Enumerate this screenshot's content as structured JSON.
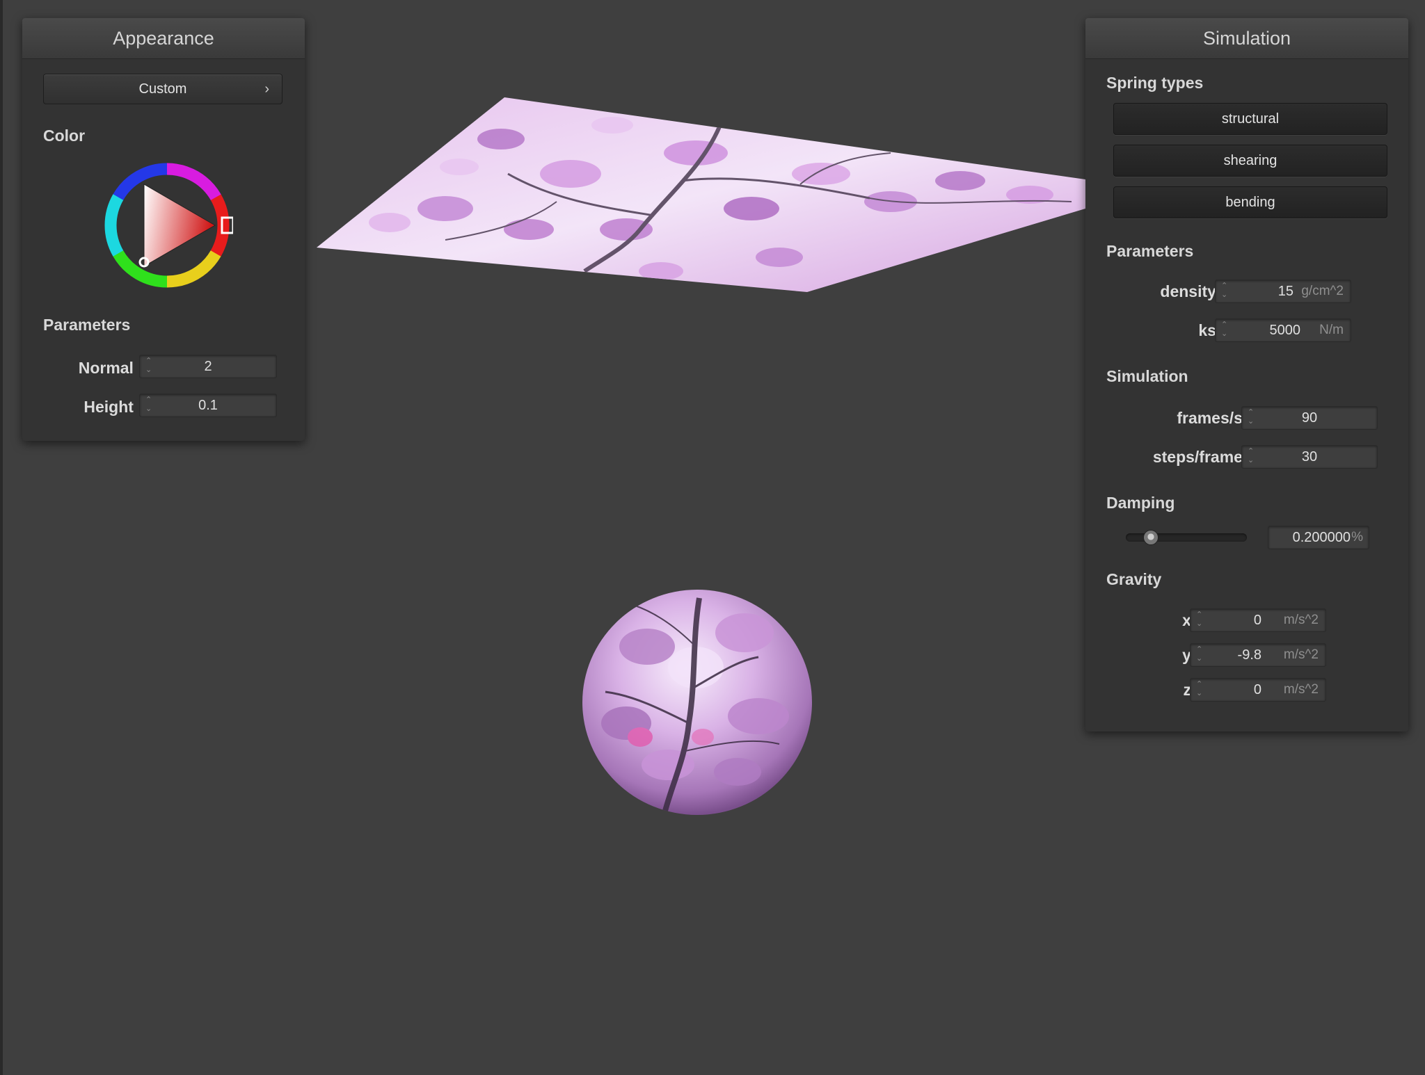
{
  "appearance": {
    "title": "Appearance",
    "preset_label": "Custom",
    "preset_chevron": "›",
    "color_label": "Color",
    "params_label": "Parameters",
    "normal_label": "Normal :",
    "normal_value": "2",
    "height_label": "Height :",
    "height_value": "0.1",
    "selected_color": "#d01818"
  },
  "simulation": {
    "title": "Simulation",
    "spring_types_label": "Spring types",
    "spring_types": [
      "structural",
      "shearing",
      "bending"
    ],
    "params_label": "Parameters",
    "density_label": "density :",
    "density_value": "15",
    "density_unit": "g/cm^2",
    "ks_label": "ks :",
    "ks_value": "5000",
    "ks_unit": "N/m",
    "sim_label": "Simulation",
    "fps_label": "frames/s :",
    "fps_value": "90",
    "steps_label": "steps/frame :",
    "steps_value": "30",
    "damping_label": "Damping",
    "damping_value": "0.200000",
    "damping_unit": "%",
    "damping_fraction": 0.2,
    "gravity_label": "Gravity",
    "gx_label": "x :",
    "gx_value": "0",
    "gy_label": "y :",
    "gy_value": "-9.8",
    "gz_label": "z :",
    "gz_value": "0",
    "gravity_unit": "m/s^2"
  },
  "icons": [
    "spin-arrows-icon",
    "chevron-right-icon",
    "color-wheel-icon"
  ]
}
